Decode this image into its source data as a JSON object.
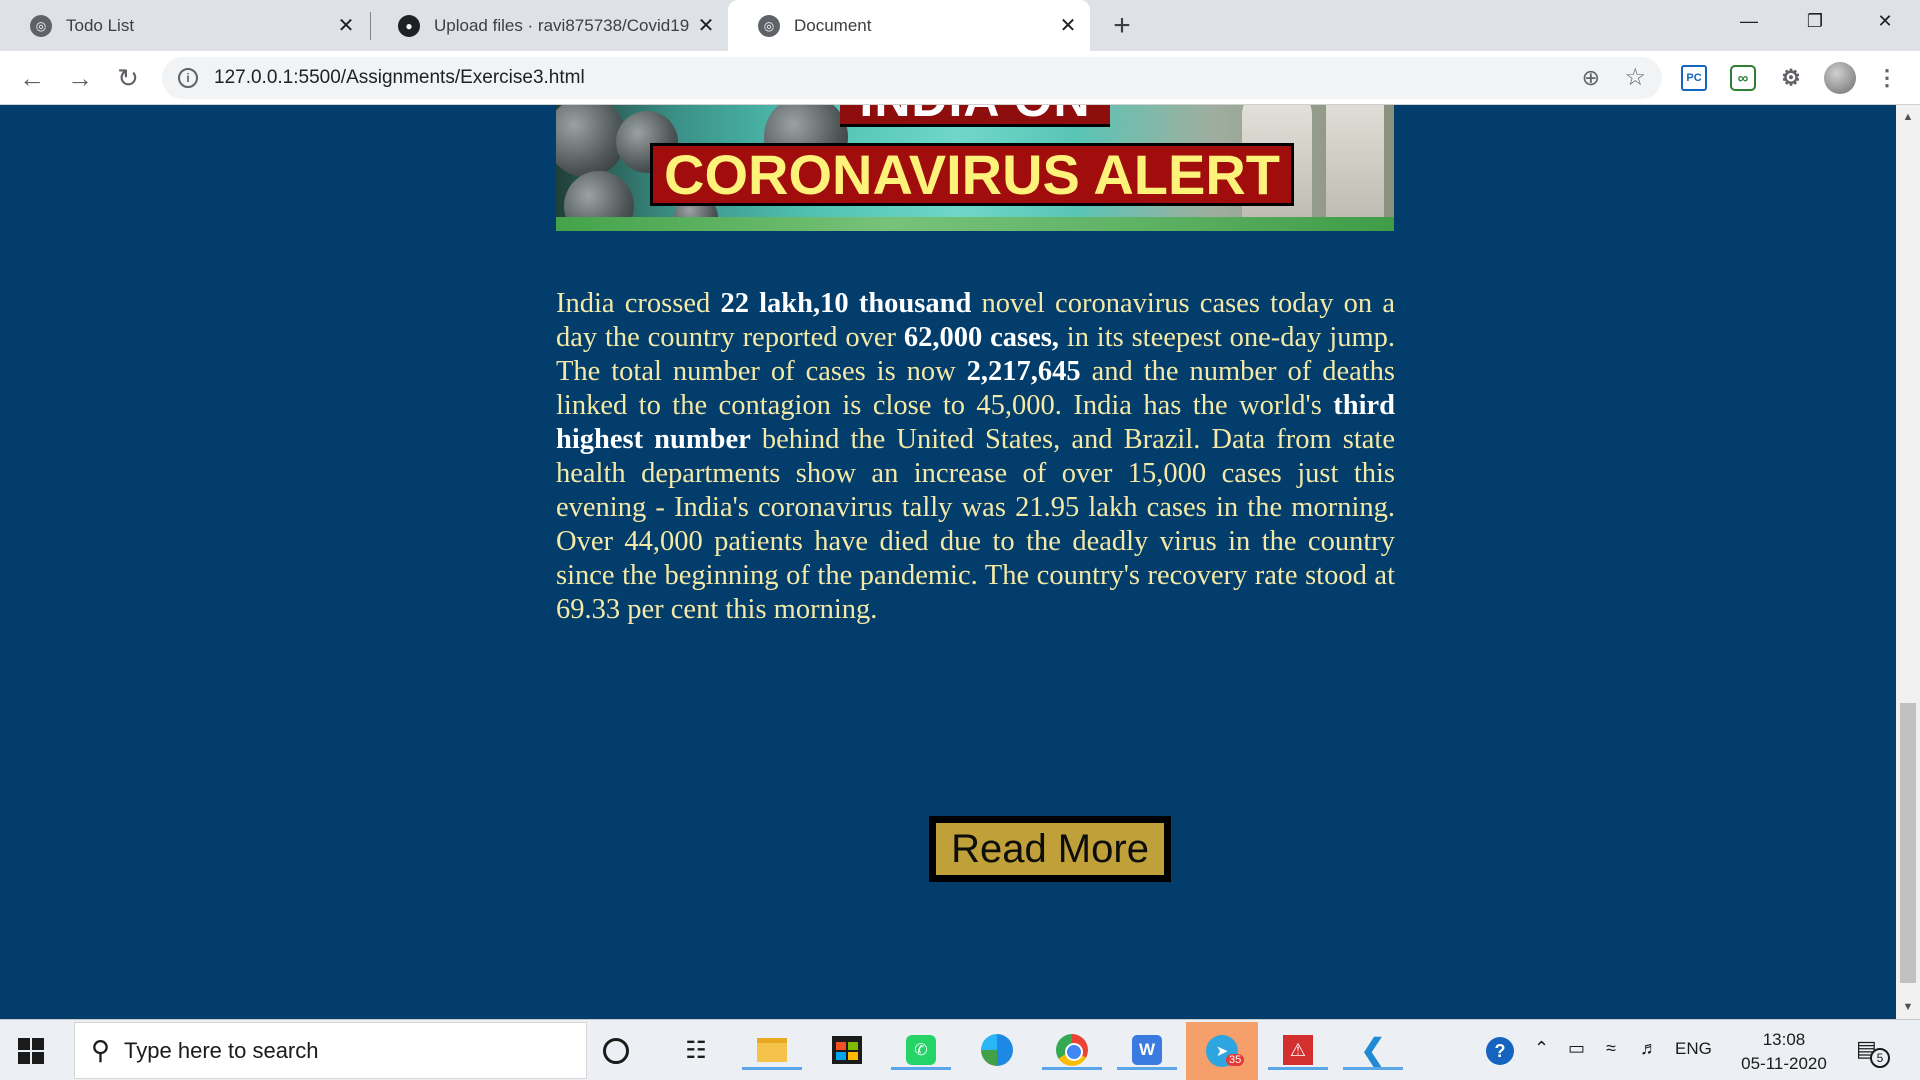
{
  "browser": {
    "tabs": [
      {
        "title": "Todo List",
        "icon": "globe-icon"
      },
      {
        "title": "Upload files · ravi875738/Covid19",
        "icon": "github-icon"
      },
      {
        "title": "Document",
        "icon": "globe-icon",
        "active": true
      }
    ],
    "new_tab_label": "+",
    "url": "127.0.0.1:5500/Assignments/Exercise3.html"
  },
  "page": {
    "banner": {
      "top_text": "INDIA ON",
      "alert_text": "CORONAVIRUS ALERT"
    },
    "article": {
      "t1": "India crossed ",
      "b1": "22 lakh,10 thousand",
      "t2": " novel coronavirus cases today on a day the country reported over ",
      "b2": "62,000 cases,",
      "t3": " in its steepest one-day jump. The total number of cases is now ",
      "b3": "2,217,645",
      "t4": " and the number of deaths linked to the contagion is close to 45,000. India has the world's ",
      "b4": "third highest number",
      "t5": " behind the United States, and Brazil. Data from state health departments show an increase of over 15,000 cases just this evening - India's coronavirus tally was 21.95 lakh cases in the morning. Over 44,000 patients have died due to the deadly virus in the country since the beginning of the pandemic. The country's recovery rate stood at 69.33 per cent this morning."
    },
    "read_more_label": "Read More",
    "colors": {
      "background": "#023d6b",
      "text": "#f4e9a6",
      "button": "#c0a039"
    }
  },
  "taskbar": {
    "search_placeholder": "Type here to search",
    "telegram_badge": "35",
    "language": "ENG",
    "time": "13:08",
    "date": "05-11-2020",
    "notification_count": "5"
  }
}
